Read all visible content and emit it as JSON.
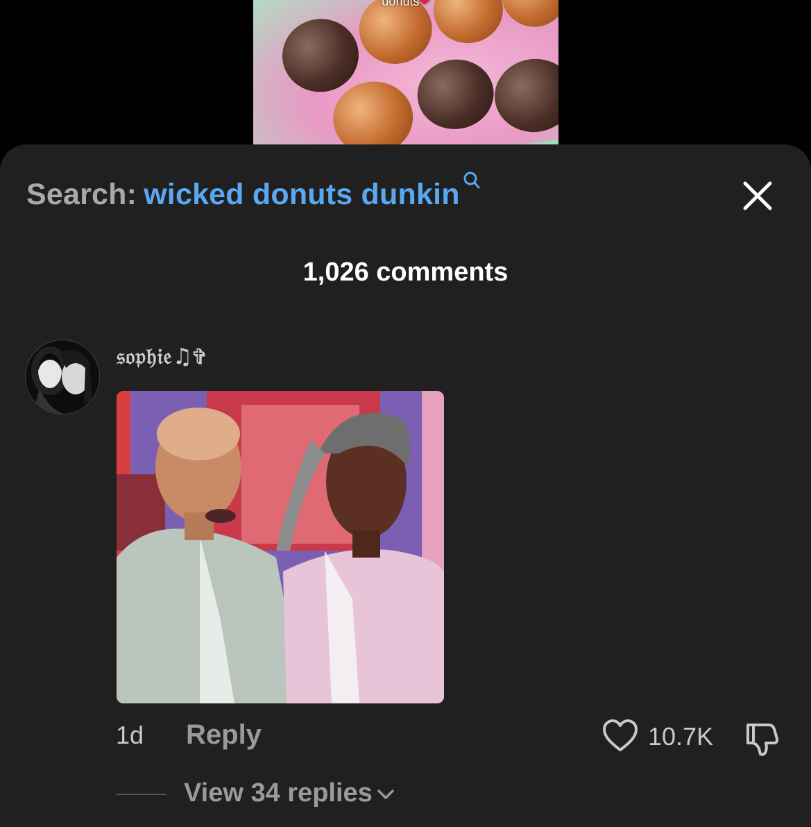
{
  "video": {
    "caption": "donuts",
    "caption_emoji": "❤"
  },
  "sheet": {
    "search_prefix": "Search:",
    "search_query": "wicked donuts dunkin",
    "comments_count": "1,026 comments"
  },
  "comment": {
    "username": "𝔰𝔬𝔭𝔥𝔦𝔢♫✞",
    "time": "1d",
    "reply_label": "Reply",
    "like_count": "10.7K",
    "view_replies_label": "View 34 replies"
  },
  "colors": {
    "sheet_bg": "#202020",
    "search_link": "#5aa8f0",
    "muted_text": "#9a9a9a"
  },
  "icons": [
    "search-icon",
    "close-icon",
    "heart-icon",
    "thumbs-down-icon",
    "chevron-down-icon"
  ]
}
